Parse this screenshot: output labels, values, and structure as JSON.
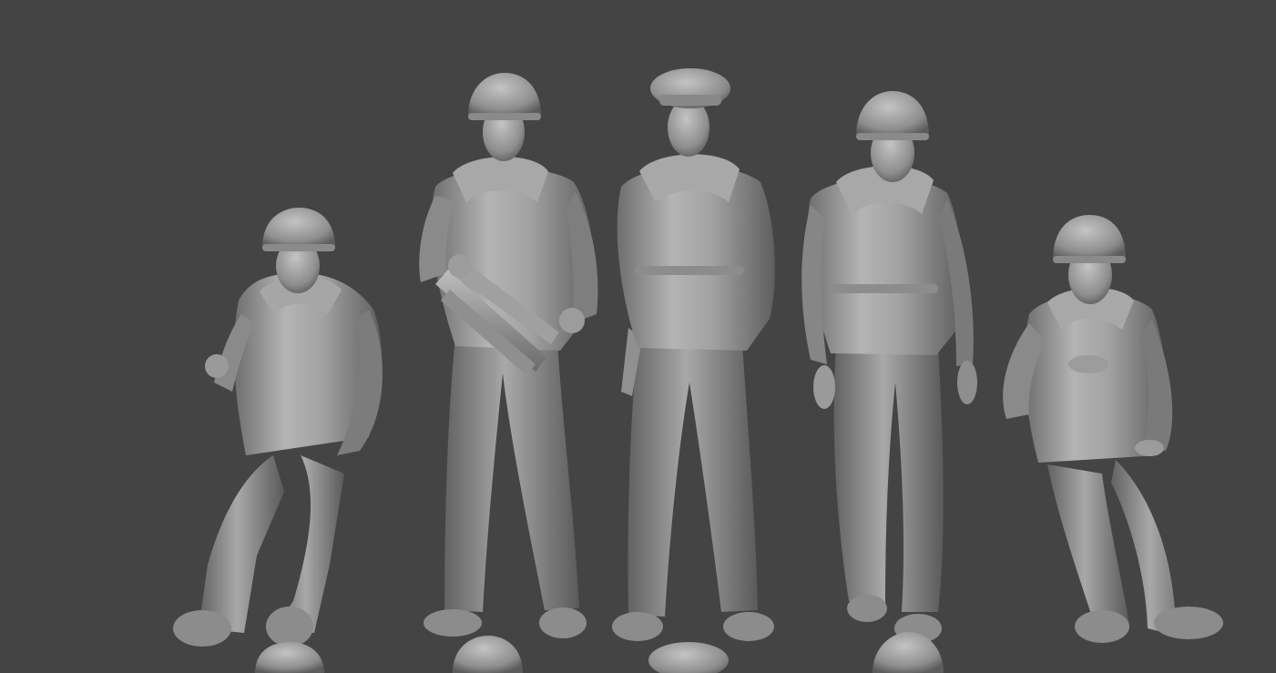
{
  "scene": {
    "background_color": "#444444",
    "model_color": "#9a9a9a",
    "figures": [
      {
        "id": "seated-helmeted-figure-left",
        "pose": "seated",
        "headgear": "helmet"
      },
      {
        "id": "standing-figure-with-tubes",
        "pose": "standing",
        "headgear": "helmet"
      },
      {
        "id": "standing-officer-with-cap",
        "pose": "standing",
        "headgear": "peaked-cap"
      },
      {
        "id": "standing-figure-arms-down",
        "pose": "standing",
        "headgear": "helmet"
      },
      {
        "id": "seated-helmeted-figure-right",
        "pose": "seated",
        "headgear": "helmet"
      }
    ],
    "partial_heads_bottom": [
      "helmet",
      "helmet",
      "peaked-cap",
      "helmet"
    ]
  }
}
